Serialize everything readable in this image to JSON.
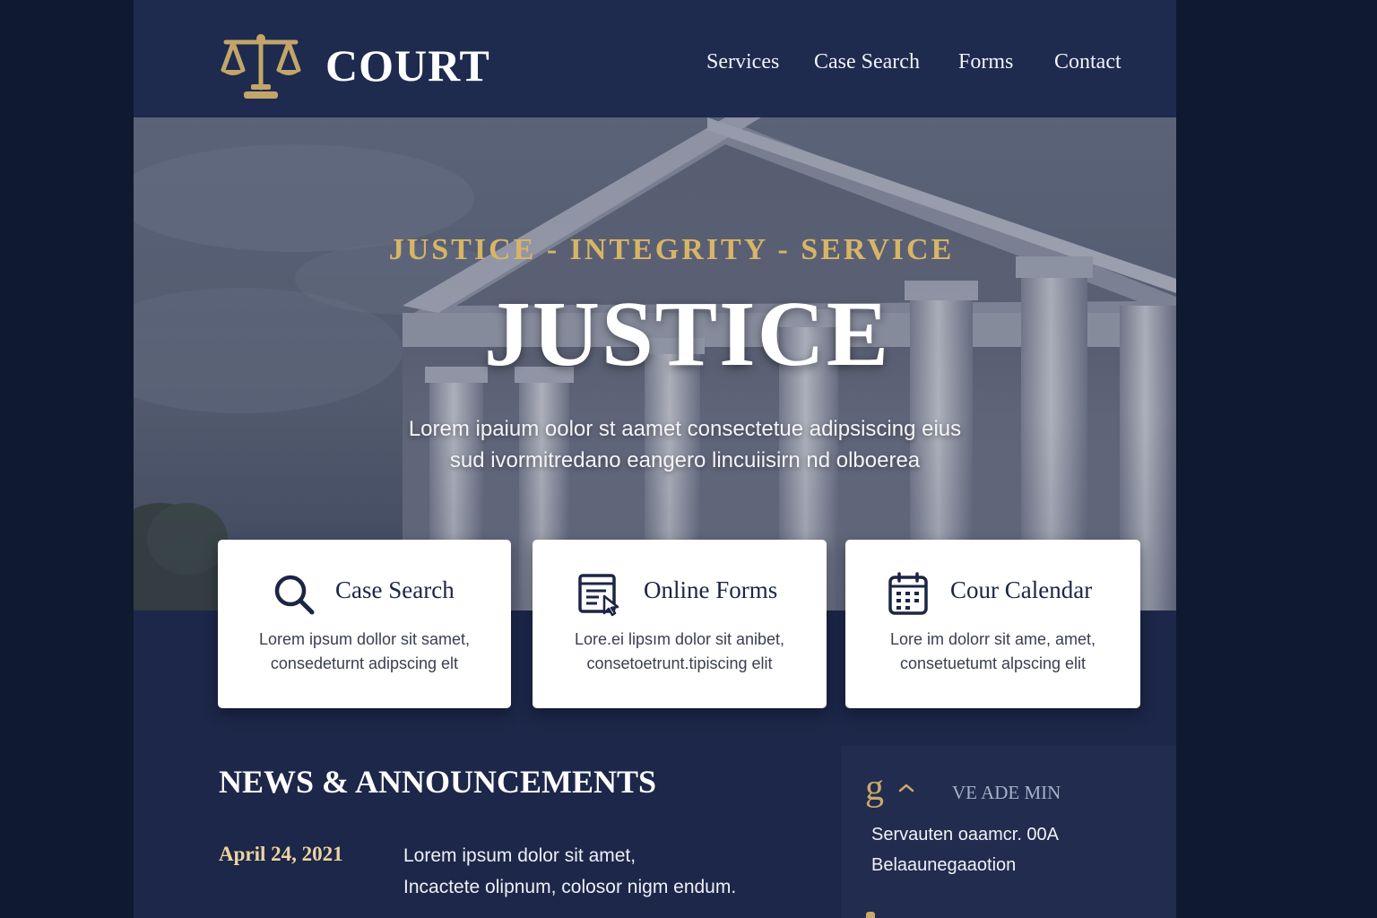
{
  "header": {
    "brand": "COURT",
    "logo_icon": "scales-of-justice-icon",
    "nav": [
      "Services",
      "Case Search",
      "Forms",
      "Contact"
    ]
  },
  "hero": {
    "tagline": "JUSTICE - INTEGRITY - SERVICE",
    "title": "JUSTICE",
    "subtitle_line1": "Lorem ipaium oolor st aamet consectetue adipsiscing eius",
    "subtitle_line2": "sud ivormitredano eangero lincuiisirn nd olboerea"
  },
  "cards": [
    {
      "title": "Case Search",
      "icon": "search-icon",
      "desc_line1": "Lorem ipsum dollor sit samet,",
      "desc_line2": "consedeturnt adipscing elt"
    },
    {
      "title": "Online Forms",
      "icon": "form-icon",
      "desc_line1": "Lore.ei lipsım dolor sit anibet,",
      "desc_line2": "consetoetrunt.tipiscing elit"
    },
    {
      "title": "Cour Calendar",
      "icon": "calendar-icon",
      "desc_line1": "Lore im dolorr sit ame, amet,",
      "desc_line2": "consetuetumt alpscing elit"
    }
  ],
  "news": {
    "heading": "NEWS & ANNOUNCEMENTS",
    "items": [
      {
        "date": "April 24, 2021",
        "line1": "Lorem ipsum dolor sit amet,",
        "line2": "Incactete olipnum, colosor nigm endum."
      }
    ]
  },
  "sidebar": {
    "glyph": "g",
    "label": "VE ADE MIN",
    "line1": "Servauten oaamcr. 00A",
    "line2": "Belaaunegaaotion"
  },
  "colors": {
    "navy": "#1c2749",
    "header": "#1e2a4e",
    "gold": "#d8b566",
    "backdrop": "#0f1a30"
  }
}
